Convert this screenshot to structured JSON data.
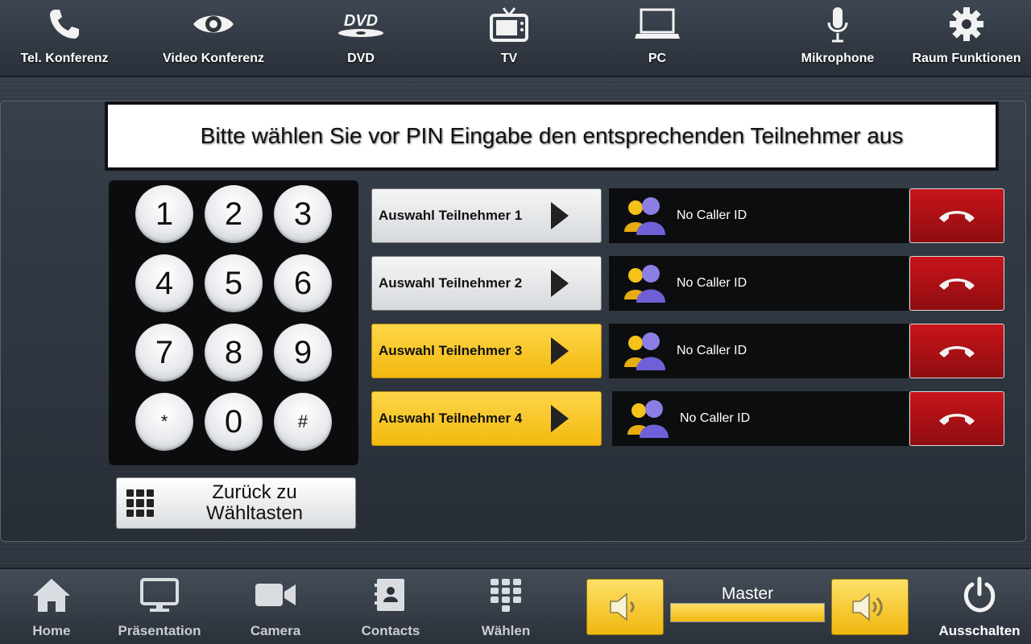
{
  "top_nav": [
    {
      "label": "Tel. Konferenz",
      "icon": "phone-icon"
    },
    {
      "label": "Video Konferenz",
      "icon": "eye-icon"
    },
    {
      "label": "DVD",
      "icon": "dvd-icon"
    },
    {
      "label": "TV",
      "icon": "tv-icon"
    },
    {
      "label": "PC",
      "icon": "laptop-icon"
    },
    {
      "label": "Mikrophone",
      "icon": "microphone-icon"
    },
    {
      "label": "Raum Funktionen",
      "icon": "gear-icon"
    }
  ],
  "banner": "Bitte wählen Sie vor PIN Eingabe den entsprechenden Teilnehmer aus",
  "keypad": [
    "1",
    "2",
    "3",
    "4",
    "5",
    "6",
    "7",
    "8",
    "9",
    "*",
    "0",
    "#"
  ],
  "back_button": {
    "line1": "Zurück zu",
    "line2": "Wähltasten"
  },
  "participants": [
    {
      "label": "Auswahl Teilnehmer 1",
      "caller": "No Caller ID",
      "state": "grey"
    },
    {
      "label": "Auswahl Teilnehmer 2",
      "caller": "No Caller ID",
      "state": "grey"
    },
    {
      "label": "Auswahl Teilnehmer 3",
      "caller": "No Caller ID",
      "state": "yellow"
    },
    {
      "label": "Auswahl Teilnehmer 4",
      "caller": "No Caller ID",
      "state": "yellow"
    }
  ],
  "bottom_nav": [
    {
      "label": "Home",
      "icon": "home-icon"
    },
    {
      "label": "Präsentation",
      "icon": "monitor-icon"
    },
    {
      "label": "Camera",
      "icon": "camera-icon"
    },
    {
      "label": "Contacts",
      "icon": "contacts-icon"
    },
    {
      "label": "Wählen",
      "icon": "dialpad-icon"
    }
  ],
  "volume": {
    "label": "Master",
    "level": 1.0
  },
  "power": {
    "label": "Ausschalten",
    "icon": "power-icon"
  },
  "colors": {
    "accent_yellow": "#f5c21a",
    "hangup_red": "#b01116",
    "caller_bg": "#0c0d0f"
  }
}
